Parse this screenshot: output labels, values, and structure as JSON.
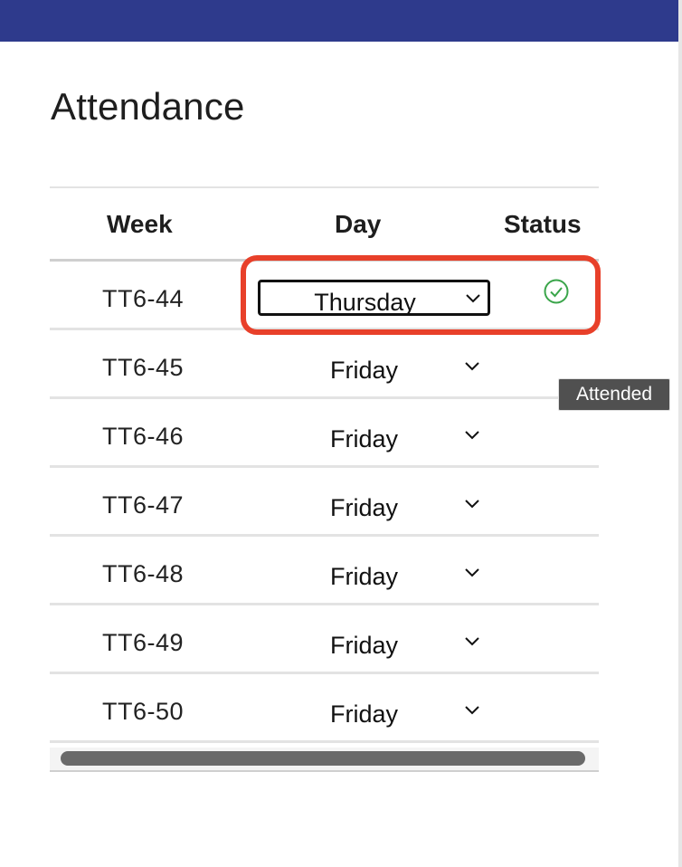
{
  "page": {
    "title": "Attendance"
  },
  "table": {
    "columns": [
      "Week",
      "Day",
      "Status"
    ],
    "rows": [
      {
        "week": "TT6-44",
        "day": "Thursday",
        "status": "attended"
      },
      {
        "week": "TT6-45",
        "day": "Friday",
        "status": ""
      },
      {
        "week": "TT6-46",
        "day": "Friday",
        "status": ""
      },
      {
        "week": "TT6-47",
        "day": "Friday",
        "status": ""
      },
      {
        "week": "TT6-48",
        "day": "Friday",
        "status": ""
      },
      {
        "week": "TT6-49",
        "day": "Friday",
        "status": ""
      },
      {
        "week": "TT6-50",
        "day": "Friday",
        "status": ""
      }
    ]
  },
  "tooltip": {
    "text": "Attended"
  },
  "icons": {
    "status": "check-circle-icon",
    "dropdown": "chevron-down-icon"
  },
  "colors": {
    "topbar": "#2e3a8c",
    "highlight": "#e8402a",
    "attended": "#3aa54a",
    "tooltip_bg": "#505050"
  }
}
